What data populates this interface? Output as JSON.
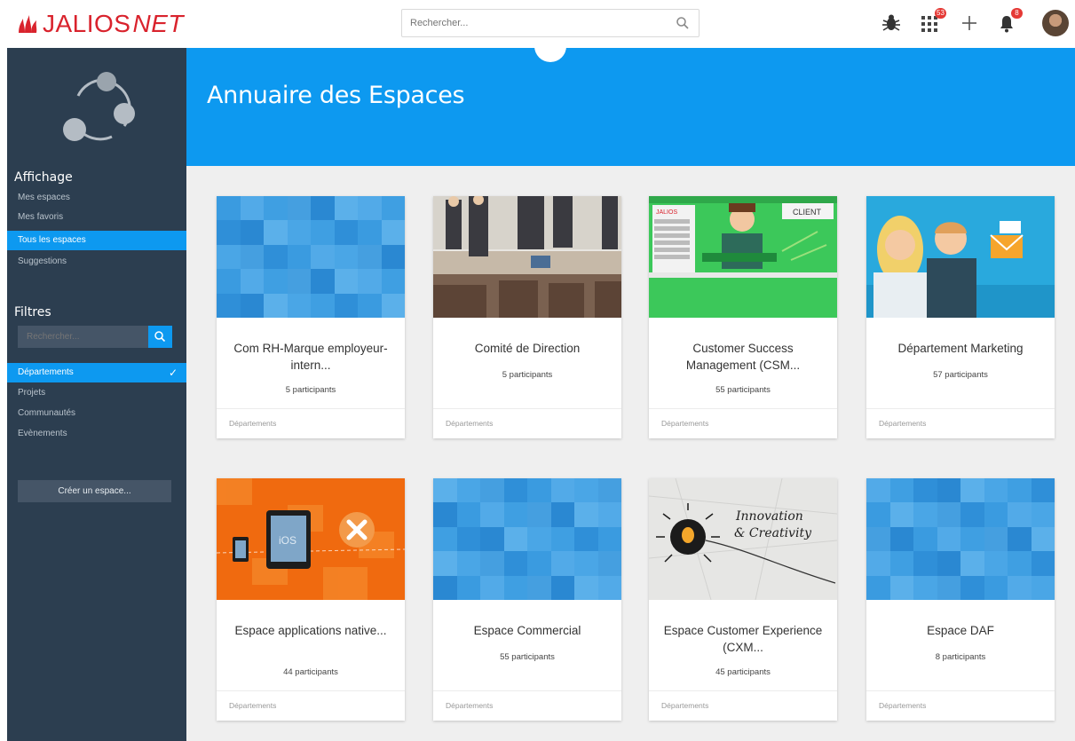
{
  "app": {
    "logo_text": "JALIOS",
    "logo_net": "NET"
  },
  "search": {
    "placeholder": "Rechercher..."
  },
  "top_icons": [
    {
      "name": "bug-icon"
    },
    {
      "name": "apps-grid-icon",
      "badge": "53"
    },
    {
      "name": "plus-icon"
    },
    {
      "name": "bell-icon",
      "badge": "8"
    }
  ],
  "sidebar": {
    "affichage_title": "Affichage",
    "affichage_items": [
      {
        "label": "Mes espaces",
        "active": false
      },
      {
        "label": "Mes favoris",
        "active": false
      },
      {
        "label": "Tous les espaces",
        "active": true
      },
      {
        "label": "Suggestions",
        "active": false
      }
    ],
    "filtres_title": "Filtres",
    "filter_search_placeholder": "Rechercher...",
    "filtres_items": [
      {
        "label": "Départements",
        "active": true
      },
      {
        "label": "Projets",
        "active": false
      },
      {
        "label": "Communautés",
        "active": false
      },
      {
        "label": "Evènements",
        "active": false
      }
    ],
    "create_label": "Créer un espace..."
  },
  "main": {
    "title": "Annuaire des Espaces",
    "cards": [
      {
        "title": "Com RH-Marque employeur-intern...",
        "count": "5 participants",
        "category": "Départements"
      },
      {
        "title": "Comité de Direction",
        "count": "5 participants",
        "category": "Départements"
      },
      {
        "title": "Customer Success Management (CSM...",
        "count": "55 participants",
        "category": "Départements",
        "image_text_1": "CLIENT",
        "image_text_2": "JALIOS"
      },
      {
        "title": "Département Marketing",
        "count": "57 participants",
        "category": "Départements"
      },
      {
        "title": "Espace applications native...",
        "count": "44 participants",
        "category": "Départements",
        "image_text_1": "iOS"
      },
      {
        "title": "Espace Commercial",
        "count": "55 participants",
        "category": "Départements"
      },
      {
        "title": "Espace Customer Experience (CXM...",
        "count": "45 participants",
        "category": "Départements",
        "image_text_1": "Innovation",
        "image_text_2": "& Creativity"
      },
      {
        "title": "Espace DAF",
        "count": "8 participants",
        "category": "Départements"
      }
    ]
  },
  "colors": {
    "brand_red": "#d9232d",
    "accent_blue": "#0d99f0",
    "sidebar_bg": "#2c3e50",
    "content_bg": "#efefef"
  }
}
